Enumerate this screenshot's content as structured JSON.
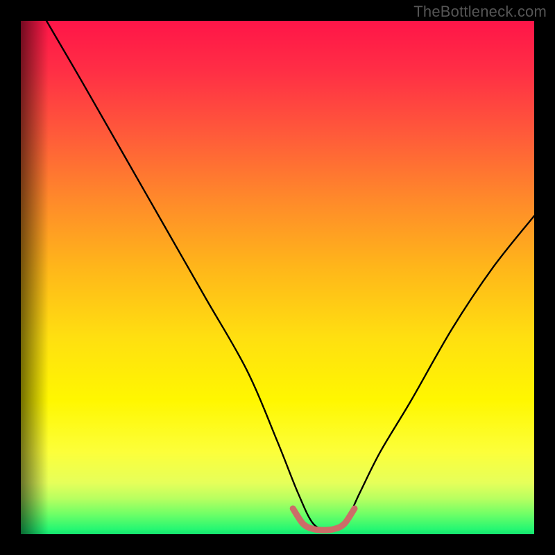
{
  "watermark": "TheBottleneck.com",
  "chart_data": {
    "type": "line",
    "title": "",
    "xlabel": "",
    "ylabel": "",
    "xlim": [
      0,
      100
    ],
    "ylim": [
      0,
      100
    ],
    "grid": false,
    "legend": false,
    "description": "V-shaped bottleneck curve over a vertical red-to-green heat gradient. The curve starts near the top-left, descends steeply to a flat minimum plateau around x≈55–62, then rises again toward the right edge.",
    "series": [
      {
        "name": "bottleneck-curve",
        "color": "#000000",
        "x": [
          5,
          12,
          20,
          28,
          36,
          44,
          50,
          54,
          57,
          60,
          63,
          66,
          70,
          76,
          84,
          92,
          100
        ],
        "y": [
          100,
          88,
          74,
          60,
          46,
          32,
          18,
          8,
          2,
          1,
          2,
          8,
          16,
          26,
          40,
          52,
          62
        ]
      },
      {
        "name": "plateau-marker",
        "color": "#cc6c68",
        "x": [
          53,
          55,
          57,
          59,
          61,
          63,
          65
        ],
        "y": [
          5,
          2,
          1,
          0.8,
          1,
          2,
          5
        ]
      }
    ]
  }
}
